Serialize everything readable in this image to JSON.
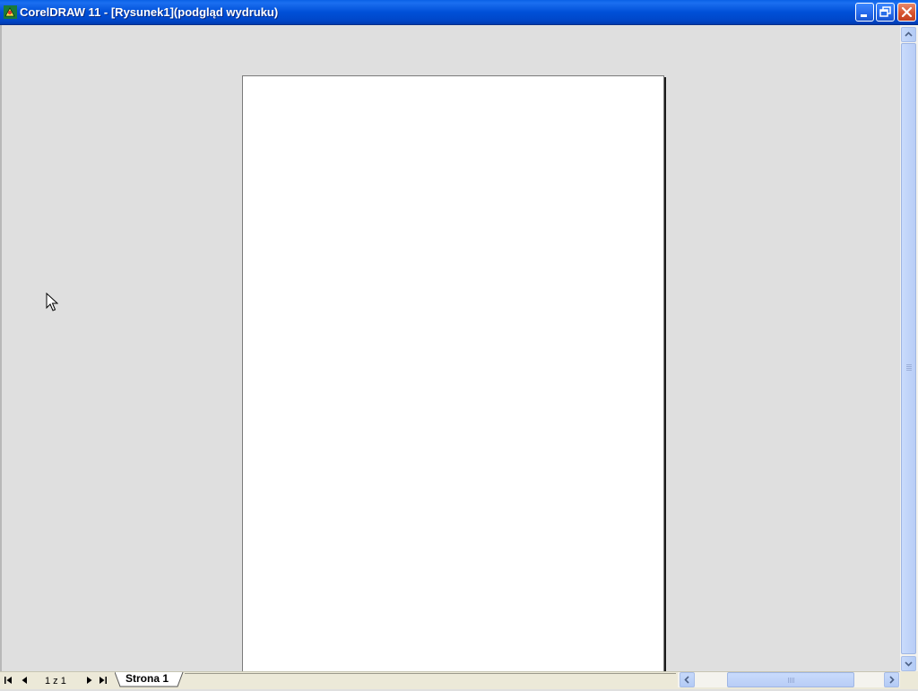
{
  "window": {
    "title": "CorelDRAW 11 - [Rysunek1](podgląd wydruku)",
    "icon": "coreldraw-balloon-icon",
    "controls": {
      "minimize_icon": "minimize-icon",
      "restore_icon": "restore-icon",
      "close_icon": "close-icon"
    }
  },
  "page_navigator": {
    "counter": "1 z 1",
    "tabs": [
      {
        "label": "Strona 1",
        "active": true
      }
    ]
  },
  "colors": {
    "titlebar": "#0050d8",
    "workspace": "#dfdfdf",
    "page": "#ffffff",
    "close_button": "#d8552f"
  }
}
